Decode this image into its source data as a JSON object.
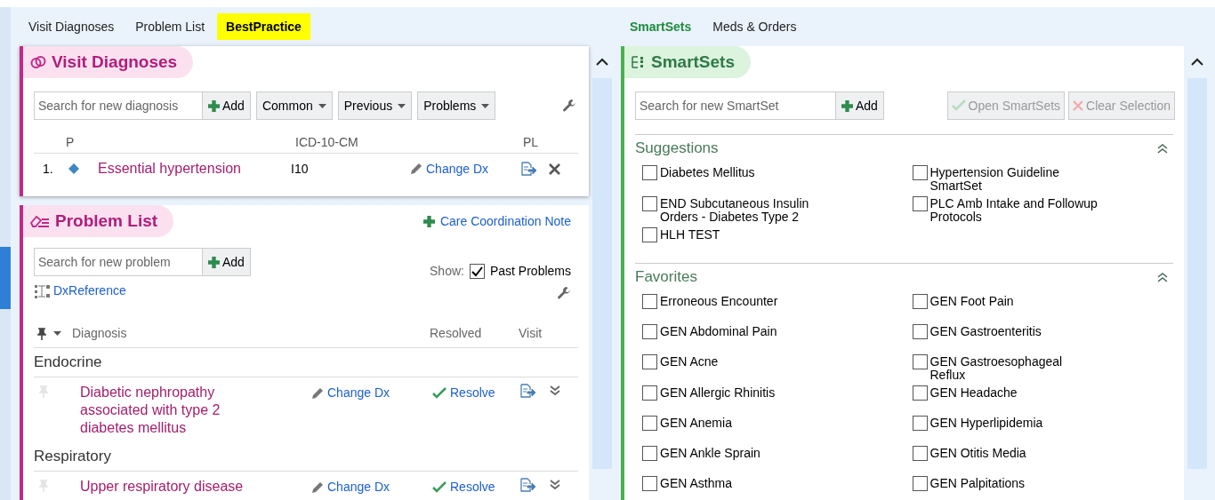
{
  "left_tabs": [
    {
      "label": "Visit Diagnoses",
      "selected": false
    },
    {
      "label": "Problem List",
      "selected": false
    },
    {
      "label": "BestPractice",
      "selected": true
    }
  ],
  "right_tabs": [
    {
      "label": "SmartSets",
      "selected": true
    },
    {
      "label": "Meds & Orders",
      "selected": false
    }
  ],
  "visit_diagnoses": {
    "title": "Visit Diagnoses",
    "search": {
      "placeholder": "Search for new diagnosis"
    },
    "add": "Add",
    "dropdowns": [
      "Common",
      "Previous",
      "Problems"
    ],
    "columns": [
      "P",
      "ICD-10-CM",
      "PL"
    ],
    "rows": [
      {
        "number": "1.",
        "diagnosis": "Essential hypertension",
        "code": "I10",
        "change": "Change Dx"
      }
    ]
  },
  "problem_list": {
    "title": "Problem List",
    "care_note": "Care Coordination Note",
    "search": {
      "placeholder": "Search for new problem"
    },
    "add": "Add",
    "show_label": "Show:",
    "past_problems": {
      "label": "Past Problems",
      "checked": true
    },
    "dx_reference": "DxReference",
    "columns": [
      "Diagnosis",
      "Resolved",
      "Visit"
    ],
    "groups": [
      {
        "name": "Endocrine",
        "problems": [
          {
            "diagnosis": "Diabetic nephropathy associated with type 2 diabetes mellitus",
            "change": "Change Dx",
            "resolve": "Resolve"
          }
        ]
      },
      {
        "name": "Respiratory",
        "problems": [
          {
            "diagnosis": "Upper respiratory disease",
            "change": "Change Dx",
            "resolve": "Resolve"
          }
        ]
      }
    ]
  },
  "smartsets": {
    "title": "SmartSets",
    "search": {
      "placeholder": "Search for new SmartSet"
    },
    "add": "Add",
    "open": {
      "label": "Open SmartSets",
      "disabled": true
    },
    "clear": {
      "label": "Clear Selection",
      "disabled": true
    },
    "sections": [
      {
        "title": "Suggestions",
        "items": [
          {
            "label": "Diabetes Mellitus",
            "checked": false
          },
          {
            "label": "Hypertension Guideline SmartSet",
            "checked": false
          },
          {
            "label": "END Subcutaneous Insulin Orders - Diabetes Type 2",
            "checked": false
          },
          {
            "label": "PLC Amb Intake and Followup Protocols",
            "checked": false
          },
          {
            "label": "HLH TEST",
            "checked": false
          }
        ]
      },
      {
        "title": "Favorites",
        "items": [
          {
            "label": "Erroneous Encounter",
            "checked": false
          },
          {
            "label": "GEN Foot Pain",
            "checked": false
          },
          {
            "label": "GEN Abdominal Pain",
            "checked": false
          },
          {
            "label": "GEN Gastroenteritis",
            "checked": false
          },
          {
            "label": "GEN Acne",
            "checked": false
          },
          {
            "label": "GEN Gastroesophageal Reflux",
            "checked": false
          },
          {
            "label": "GEN Allergic Rhinitis",
            "checked": false
          },
          {
            "label": "GEN Headache",
            "checked": false
          },
          {
            "label": "GEN Anemia",
            "checked": false
          },
          {
            "label": "GEN Hyperlipidemia",
            "checked": false
          },
          {
            "label": "GEN Ankle Sprain",
            "checked": false
          },
          {
            "label": "GEN Otitis Media",
            "checked": false
          },
          {
            "label": "GEN Asthma",
            "checked": false
          },
          {
            "label": "GEN Palpitations",
            "checked": false
          }
        ]
      }
    ]
  }
}
